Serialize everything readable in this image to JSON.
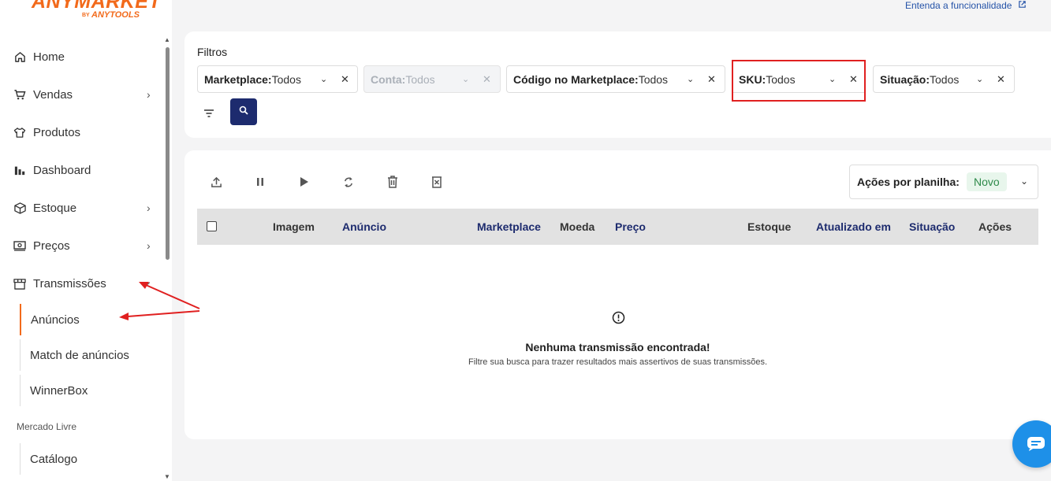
{
  "logo": {
    "brand": "ANYMARKET",
    "by": "BY",
    "sub": "ANYTOOLS"
  },
  "top_link": {
    "label": "Entenda a funcionalidade"
  },
  "sidebar": {
    "items": [
      {
        "label": "Home",
        "icon": "home-icon"
      },
      {
        "label": "Vendas",
        "icon": "cart-icon",
        "expandable": true
      },
      {
        "label": "Produtos",
        "icon": "shirt-icon"
      },
      {
        "label": "Dashboard",
        "icon": "bar-chart-icon"
      },
      {
        "label": "Estoque",
        "icon": "box-icon",
        "expandable": true
      },
      {
        "label": "Preços",
        "icon": "money-icon",
        "expandable": true
      },
      {
        "label": "Transmissões",
        "icon": "store-icon",
        "expanded": true
      }
    ],
    "sub_items": [
      {
        "label": "Anúncios",
        "active": true
      },
      {
        "label": "Match de anúncios"
      },
      {
        "label": "WinnerBox"
      }
    ],
    "section_label": "Mercado Livre",
    "section_items": [
      {
        "label": "Catálogo"
      }
    ]
  },
  "filters": {
    "title": "Filtros",
    "chips": [
      {
        "name": "Marketplace:",
        "value": " Todos",
        "disabled": false
      },
      {
        "name": "Conta:",
        "value": " Todos",
        "disabled": true
      },
      {
        "name": "Código no Marketplace:",
        "value": "Todos",
        "disabled": false
      },
      {
        "name": "SKU:",
        "value": "Todos",
        "disabled": false
      },
      {
        "name": "Situação:",
        "value": "Todos",
        "disabled": false
      }
    ]
  },
  "table": {
    "actions_select": {
      "label": "Ações por planilha:",
      "value": "Novo"
    },
    "columns": [
      "Imagem",
      "Anúncio",
      "Marketplace",
      "Moeda",
      "Preço",
      "Estoque",
      "Atualizado em",
      "Situação",
      "Ações"
    ],
    "empty_title": "Nenhuma transmissão encontrada!",
    "empty_subtitle": "Filtre sua busca para trazer resultados mais assertivos de suas transmissões."
  },
  "colors": {
    "accent": "#f26a1b",
    "primary": "#1d2b6e",
    "highlight": "#e02020",
    "chat": "#1e90e8"
  }
}
